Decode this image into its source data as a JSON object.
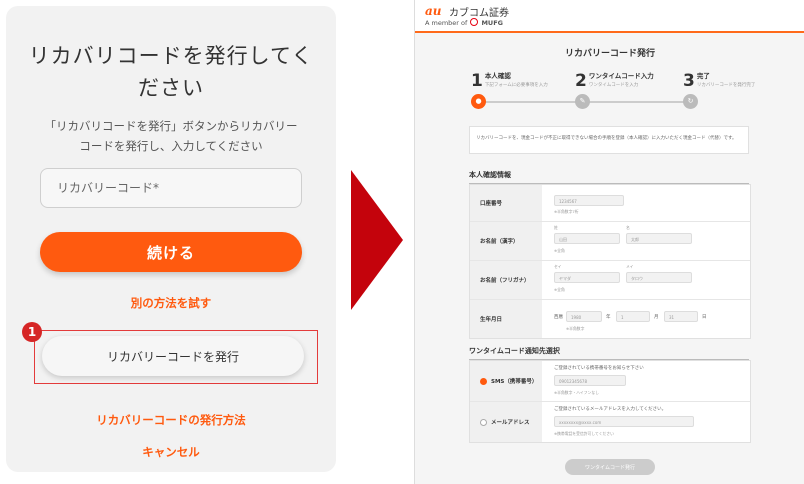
{
  "left": {
    "title_line1": "リカバリコードを発行してく",
    "title_line2": "ださい",
    "desc_line1": "「リカバリコードを発行」ボタンからリカバリー",
    "desc_line2": "コードを発行し、入力してください",
    "input_placeholder": "リカバリーコード*",
    "continue_label": "続ける",
    "alt_method_link": "別の方法を試す",
    "step_badge": "1",
    "issue_button_label": "リカバリーコードを発行",
    "how_to_link": "リカバリーコードの発行方法",
    "cancel_link": "キャンセル",
    "accent_color": "#ff5a0f",
    "highlight_color": "#e33b3b"
  },
  "arrow_color": "#c4030c",
  "right": {
    "logo_mark": "au",
    "logo_text": "カブコム証券",
    "member_prefix": "A member of",
    "member_brand": "MUFG",
    "page_title": "リカバリーコード発行",
    "steps": [
      {
        "num": "1",
        "label": "本人確認",
        "sub": "下記フォームに必要事項を入力"
      },
      {
        "num": "2",
        "label": "ワンタイムコード入力",
        "sub": "ワンタイムコードを入力"
      },
      {
        "num": "3",
        "label": "完了",
        "sub": "リカバリーコードを発行完了"
      }
    ],
    "notice": "リカバリーコードを、現金コードが不正に取得できない場合の手順を登録（本人確認）に入力いただく現金コード（代替）です。",
    "section1_title": "本人確認情報",
    "rows": {
      "account_label": "口座番号",
      "account_value": "1234567",
      "account_note": "※半角数字7桁",
      "name_kanji_label": "お名前（漢字）",
      "name_kanji_sei_cap": "姓",
      "name_kanji_mei_cap": "名",
      "name_kanji_sei": "山田",
      "name_kanji_mei": "太郎",
      "name_kanji_note": "※全角",
      "name_kana_label": "お名前（フリガナ）",
      "name_kana_sei_cap": "セイ",
      "name_kana_mei_cap": "メイ",
      "name_kana_sei": "ヤマダ",
      "name_kana_mei": "タロウ",
      "name_kana_note": "※全角",
      "birth_label": "生年月日",
      "birth_era": "西暦",
      "birth_year": "1980",
      "birth_year_unit": "年",
      "birth_month": "1",
      "birth_month_unit": "月",
      "birth_day": "31",
      "birth_day_unit": "日",
      "birth_note": "※半角数字"
    },
    "section2_title": "ワンタイムコード通知先選択",
    "sms_label": "SMS（携帯番号）",
    "sms_hint": "ご登録されている携帯番号をお知らせ下さい",
    "sms_value": "09012345678",
    "sms_note": "※半角数字・ハイフンなし",
    "mail_label": "メールアドレス",
    "mail_hint": "ご登録されているメールアドレスを入力してください。",
    "mail_value": "xxxxxxxx@xxxx.com",
    "mail_note": "※携帯電話を受信許可してください",
    "submit_label": "ワンタイムコード発行"
  }
}
